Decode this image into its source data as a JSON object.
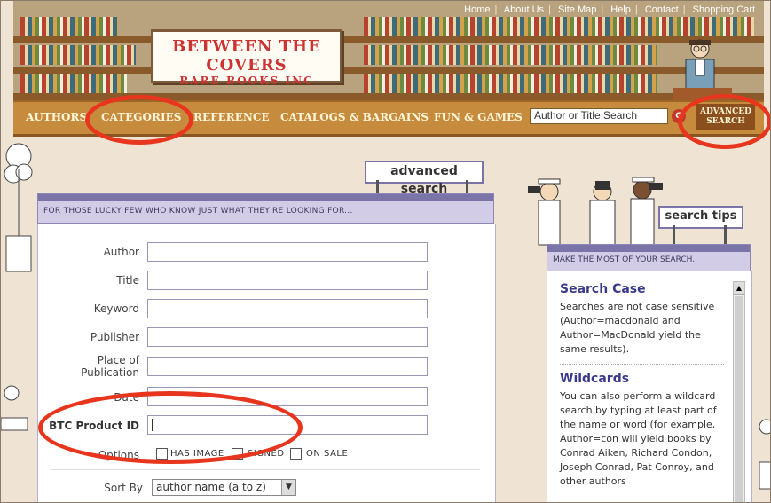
{
  "top_links": [
    "Home",
    "About Us",
    "Site Map",
    "Help",
    "Contact",
    "Shopping Cart"
  ],
  "logo": {
    "line1": "BETWEEN THE COVERS",
    "line2": "RARE BOOKS INC"
  },
  "nav": {
    "items": [
      "AUTHORS",
      "CATEGORIES",
      "REFERENCE",
      "CATALOGS & BARGAINS",
      "FUN & GAMES"
    ],
    "search_value": "Author or Title Search",
    "go_label": "G",
    "advanced_button": "ADVANCED SEARCH"
  },
  "advanced": {
    "tag": "advanced search",
    "subtitle": "FOR THOSE LUCKY FEW WHO KNOW JUST WHAT THEY'RE LOOKING FOR...",
    "fields": [
      {
        "label": "Author"
      },
      {
        "label": "Title"
      },
      {
        "label": "Keyword"
      },
      {
        "label": "Publisher"
      },
      {
        "label": "Place of Publication"
      },
      {
        "label": "Date"
      },
      {
        "label": "BTC Product ID"
      }
    ],
    "options_label": "Options",
    "checkboxes": [
      "HAS IMAGE",
      "SIGNED",
      "ON SALE"
    ],
    "sort_label": "Sort By",
    "sort_value": "author name (a to z)"
  },
  "tips": {
    "tag": "search tips",
    "subtitle": "MAKE THE MOST OF YOUR SEARCH.",
    "sections": [
      {
        "title": "Search Case",
        "body": "Searches are not case sensitive (Author=macdonald and Author=MacDonald yield the same results)."
      },
      {
        "title": "Wildcards",
        "body": "You can also perform a wildcard search by typing at least part of the name or word (for example, Author=con will yield books by Conrad Aiken, Richard Condon, Joseph Conrad, Pat Conroy, and other authors"
      }
    ]
  },
  "colors": {
    "highlight": "#e8361e",
    "panel": "#7a74a8",
    "nav": "#c78b3e"
  }
}
